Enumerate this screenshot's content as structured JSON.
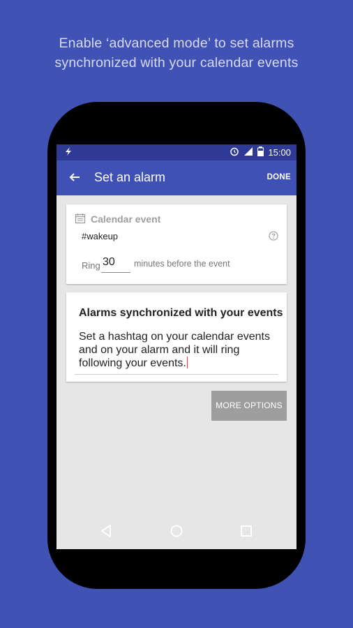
{
  "promo": {
    "line1": "Enable ‘advanced mode’ to set alarms",
    "line2": "synchronized with your calendar events"
  },
  "status_bar": {
    "time": "15:00",
    "icons": [
      "flash-icon",
      "alarm-icon",
      "signal-icon",
      "battery-icon"
    ]
  },
  "app_bar": {
    "title": "Set an alarm",
    "done_label": "DONE",
    "back_icon": "arrow-left-icon"
  },
  "calendar_card": {
    "title": "Calendar event",
    "hashtag": "#wakeup",
    "ring_label": "Ring",
    "ring_value": "30",
    "ring_suffix": "minutes before the event"
  },
  "sync_card": {
    "title": "Alarms synchronized with your events",
    "body": "Set a hashtag on your calendar events and on your alarm and it will ring following your events."
  },
  "more_options_label": "MORE OPTIONS",
  "nav_bar": {
    "icons": [
      "back-triangle-icon",
      "home-circle-icon",
      "recents-square-icon"
    ]
  },
  "colors": {
    "background": "#4152b5",
    "app_bar": "#3f51b5",
    "status_bar": "#2e3a94",
    "caret": "#e53935"
  }
}
